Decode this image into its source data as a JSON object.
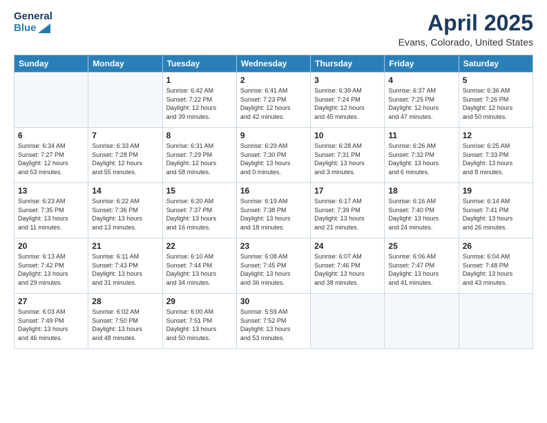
{
  "header": {
    "logo_line1": "General",
    "logo_line2": "Blue",
    "month": "April 2025",
    "location": "Evans, Colorado, United States"
  },
  "weekdays": [
    "Sunday",
    "Monday",
    "Tuesday",
    "Wednesday",
    "Thursday",
    "Friday",
    "Saturday"
  ],
  "weeks": [
    [
      {
        "day": "",
        "info": ""
      },
      {
        "day": "",
        "info": ""
      },
      {
        "day": "1",
        "info": "Sunrise: 6:42 AM\nSunset: 7:22 PM\nDaylight: 12 hours\nand 39 minutes."
      },
      {
        "day": "2",
        "info": "Sunrise: 6:41 AM\nSunset: 7:23 PM\nDaylight: 12 hours\nand 42 minutes."
      },
      {
        "day": "3",
        "info": "Sunrise: 6:39 AM\nSunset: 7:24 PM\nDaylight: 12 hours\nand 45 minutes."
      },
      {
        "day": "4",
        "info": "Sunrise: 6:37 AM\nSunset: 7:25 PM\nDaylight: 12 hours\nand 47 minutes."
      },
      {
        "day": "5",
        "info": "Sunrise: 6:36 AM\nSunset: 7:26 PM\nDaylight: 12 hours\nand 50 minutes."
      }
    ],
    [
      {
        "day": "6",
        "info": "Sunrise: 6:34 AM\nSunset: 7:27 PM\nDaylight: 12 hours\nand 53 minutes."
      },
      {
        "day": "7",
        "info": "Sunrise: 6:33 AM\nSunset: 7:28 PM\nDaylight: 12 hours\nand 55 minutes."
      },
      {
        "day": "8",
        "info": "Sunrise: 6:31 AM\nSunset: 7:29 PM\nDaylight: 12 hours\nand 58 minutes."
      },
      {
        "day": "9",
        "info": "Sunrise: 6:29 AM\nSunset: 7:30 PM\nDaylight: 13 hours\nand 0 minutes."
      },
      {
        "day": "10",
        "info": "Sunrise: 6:28 AM\nSunset: 7:31 PM\nDaylight: 13 hours\nand 3 minutes."
      },
      {
        "day": "11",
        "info": "Sunrise: 6:26 AM\nSunset: 7:32 PM\nDaylight: 13 hours\nand 6 minutes."
      },
      {
        "day": "12",
        "info": "Sunrise: 6:25 AM\nSunset: 7:33 PM\nDaylight: 13 hours\nand 8 minutes."
      }
    ],
    [
      {
        "day": "13",
        "info": "Sunrise: 6:23 AM\nSunset: 7:35 PM\nDaylight: 13 hours\nand 11 minutes."
      },
      {
        "day": "14",
        "info": "Sunrise: 6:22 AM\nSunset: 7:36 PM\nDaylight: 13 hours\nand 13 minutes."
      },
      {
        "day": "15",
        "info": "Sunrise: 6:20 AM\nSunset: 7:37 PM\nDaylight: 13 hours\nand 16 minutes."
      },
      {
        "day": "16",
        "info": "Sunrise: 6:19 AM\nSunset: 7:38 PM\nDaylight: 13 hours\nand 18 minutes."
      },
      {
        "day": "17",
        "info": "Sunrise: 6:17 AM\nSunset: 7:39 PM\nDaylight: 13 hours\nand 21 minutes."
      },
      {
        "day": "18",
        "info": "Sunrise: 6:16 AM\nSunset: 7:40 PM\nDaylight: 13 hours\nand 24 minutes."
      },
      {
        "day": "19",
        "info": "Sunrise: 6:14 AM\nSunset: 7:41 PM\nDaylight: 13 hours\nand 26 minutes."
      }
    ],
    [
      {
        "day": "20",
        "info": "Sunrise: 6:13 AM\nSunset: 7:42 PM\nDaylight: 13 hours\nand 29 minutes."
      },
      {
        "day": "21",
        "info": "Sunrise: 6:11 AM\nSunset: 7:43 PM\nDaylight: 13 hours\nand 31 minutes."
      },
      {
        "day": "22",
        "info": "Sunrise: 6:10 AM\nSunset: 7:44 PM\nDaylight: 13 hours\nand 34 minutes."
      },
      {
        "day": "23",
        "info": "Sunrise: 6:08 AM\nSunset: 7:45 PM\nDaylight: 13 hours\nand 36 minutes."
      },
      {
        "day": "24",
        "info": "Sunrise: 6:07 AM\nSunset: 7:46 PM\nDaylight: 13 hours\nand 38 minutes."
      },
      {
        "day": "25",
        "info": "Sunrise: 6:06 AM\nSunset: 7:47 PM\nDaylight: 13 hours\nand 41 minutes."
      },
      {
        "day": "26",
        "info": "Sunrise: 6:04 AM\nSunset: 7:48 PM\nDaylight: 13 hours\nand 43 minutes."
      }
    ],
    [
      {
        "day": "27",
        "info": "Sunrise: 6:03 AM\nSunset: 7:49 PM\nDaylight: 13 hours\nand 46 minutes."
      },
      {
        "day": "28",
        "info": "Sunrise: 6:02 AM\nSunset: 7:50 PM\nDaylight: 13 hours\nand 48 minutes."
      },
      {
        "day": "29",
        "info": "Sunrise: 6:00 AM\nSunset: 7:51 PM\nDaylight: 13 hours\nand 50 minutes."
      },
      {
        "day": "30",
        "info": "Sunrise: 5:59 AM\nSunset: 7:52 PM\nDaylight: 13 hours\nand 53 minutes."
      },
      {
        "day": "",
        "info": ""
      },
      {
        "day": "",
        "info": ""
      },
      {
        "day": "",
        "info": ""
      }
    ]
  ]
}
